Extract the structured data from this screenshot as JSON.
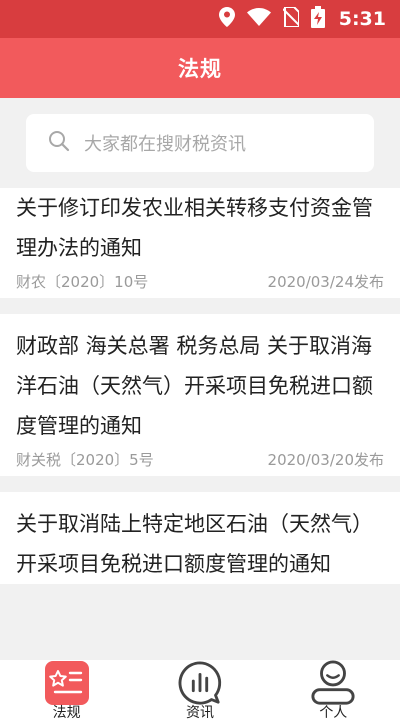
{
  "status_bar": {
    "time": "5:31"
  },
  "header": {
    "title": "法规"
  },
  "search": {
    "placeholder": "大家都在搜财税资讯"
  },
  "articles": [
    {
      "title": "关于修订印发农业相关转移支付资金管理办法的通知",
      "doc_no": "财农〔2020〕10号",
      "date": "2020/03/24发布"
    },
    {
      "title": "财政部 海关总署 税务总局 关于取消海洋石油（天然气）开采项目免税进口额度管理的通知",
      "doc_no": "财关税〔2020〕5号",
      "date": "2020/03/20发布"
    },
    {
      "title": "关于取消陆上特定地区石油（天然气）开采项目免税进口额度管理的通知",
      "doc_no": "",
      "date": ""
    }
  ],
  "tabs": [
    {
      "label": "法规",
      "active": true
    },
    {
      "label": "资讯",
      "active": false
    },
    {
      "label": "个人",
      "active": false
    }
  ],
  "colors": {
    "status_bar": "#d83d3f",
    "header": "#f25a5c",
    "accent": "#f25a5c",
    "background": "#f1f1f1"
  }
}
